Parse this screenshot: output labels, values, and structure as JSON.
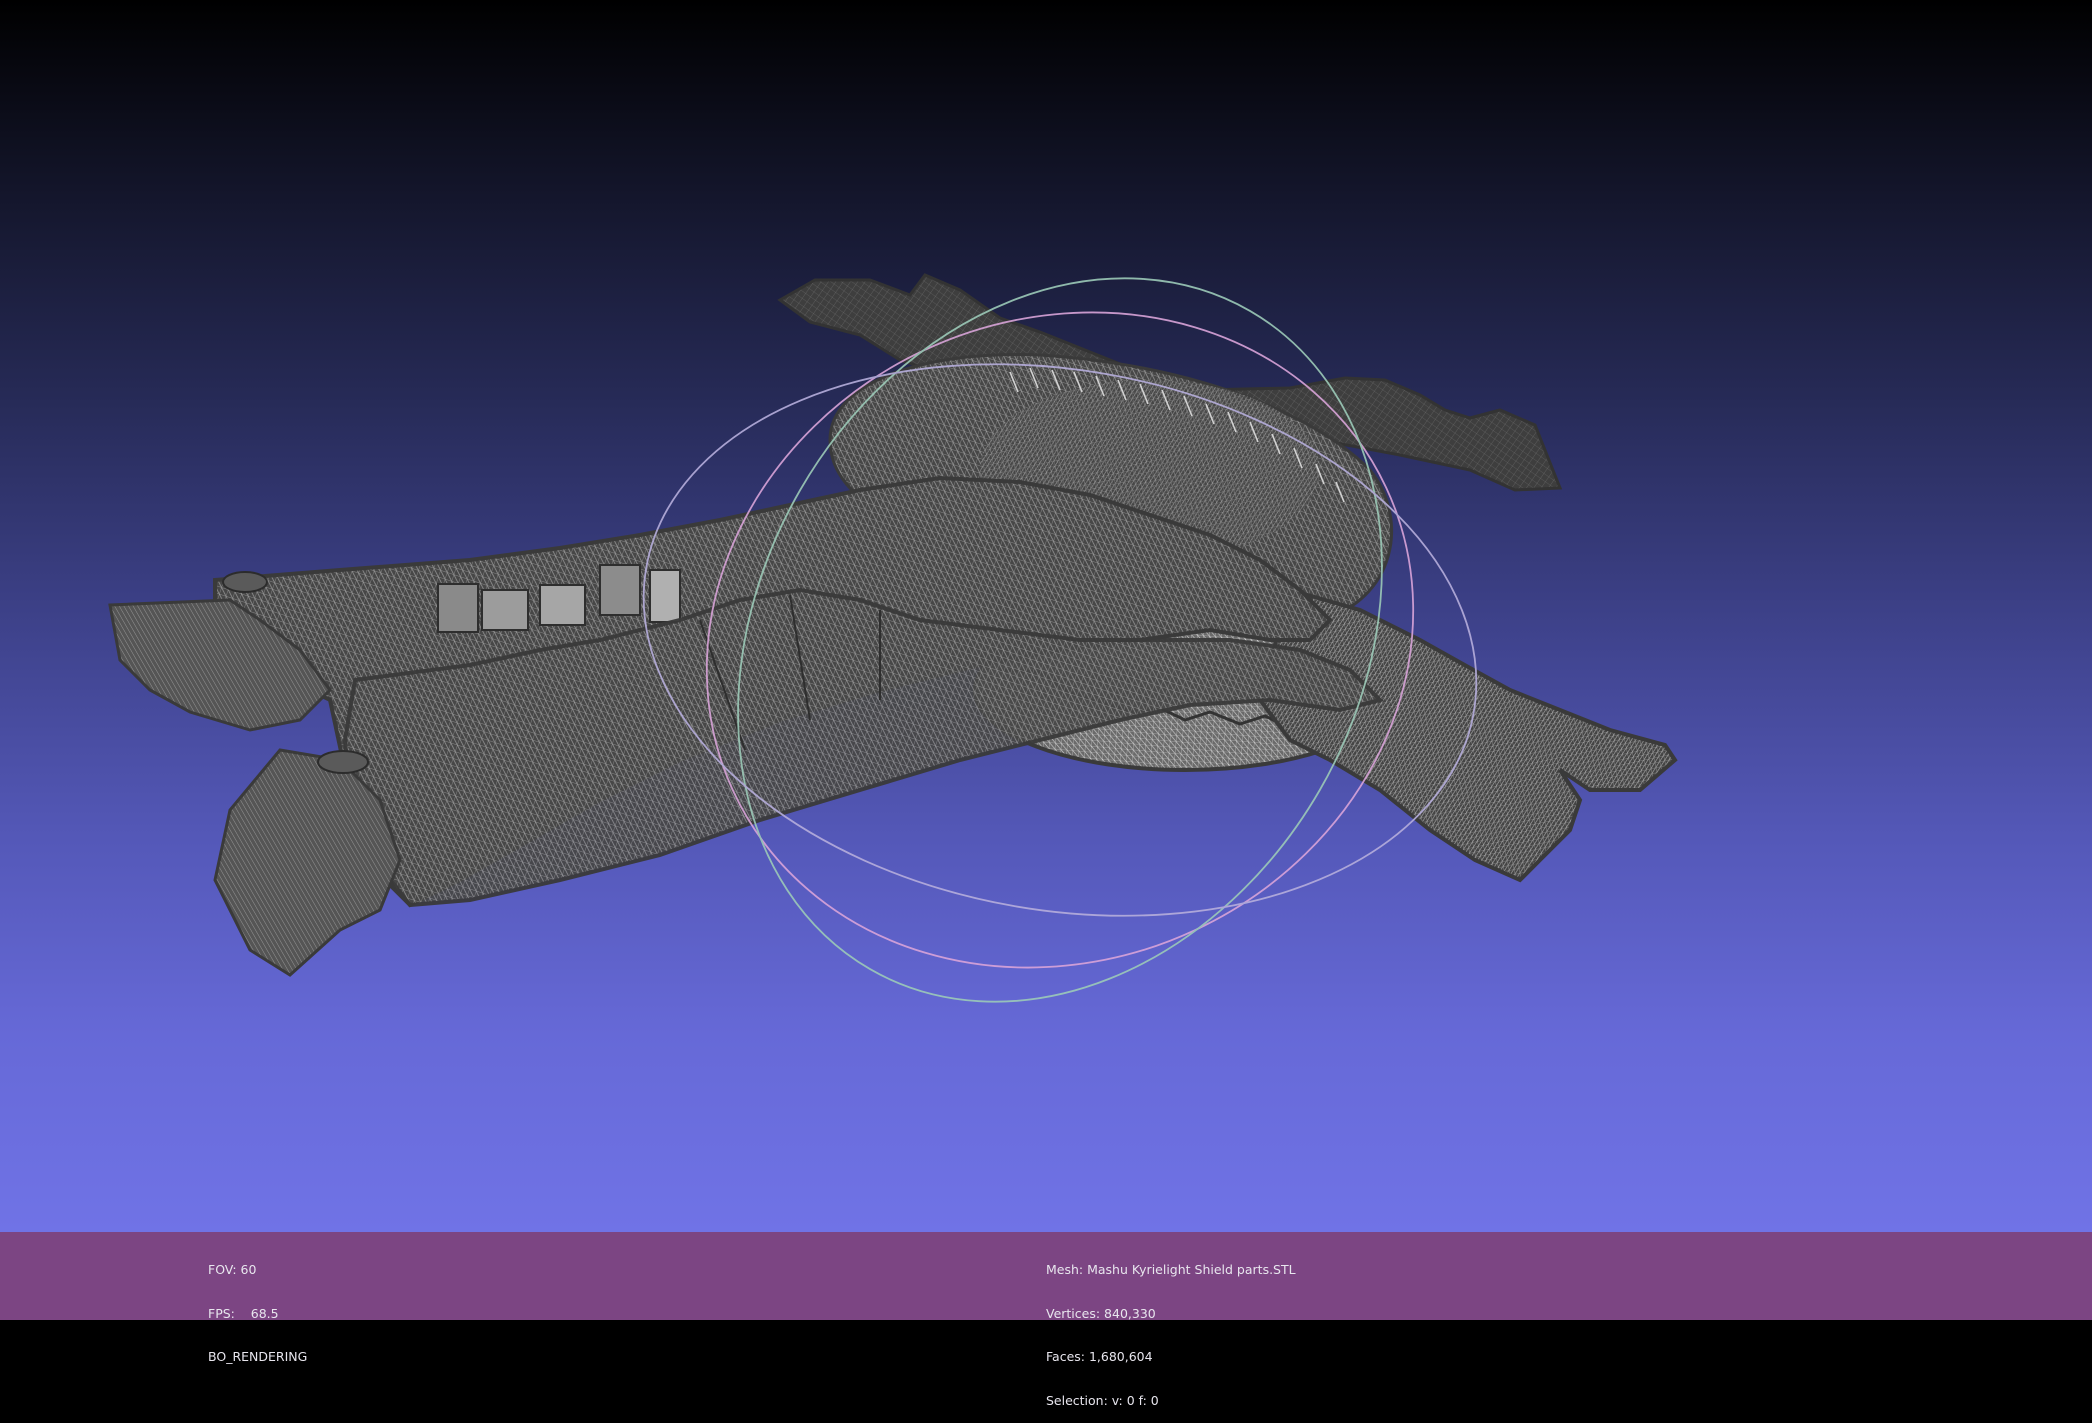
{
  "viewer": {
    "background_top": "#000000",
    "background_bottom": "#7073e6",
    "mesh_color": "#434343",
    "wire_color": "#a8a8a8",
    "trackball_colors": [
      "#ff5a5a",
      "#6cf06c",
      "#8a8aff"
    ]
  },
  "status_left": {
    "fov": "FOV: 60",
    "fps": "FPS:    68.5",
    "mode": "BO_RENDERING"
  },
  "status_right": {
    "mesh": "Mesh: Mashu Kyrielight Shield parts.STL",
    "vertices": "Vertices: 840,330",
    "faces": "Faces: 1,680,604",
    "selection": "Selection: v: 0 f: 0"
  }
}
